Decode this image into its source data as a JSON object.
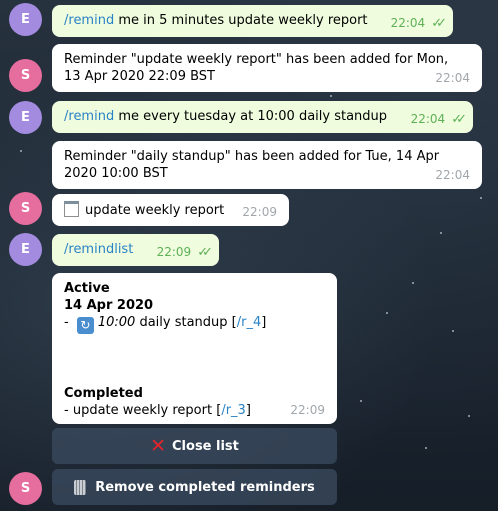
{
  "colors": {
    "outgoing_bubble": "#effdde",
    "incoming_bubble": "#ffffff",
    "link": "#2a83c5",
    "time_outgoing": "#5fb057",
    "avatar_e": "#a38be0",
    "avatar_s": "#e66e9e"
  },
  "avatars": {
    "user": "E",
    "bot": "S"
  },
  "messages": {
    "m1": {
      "command": "/remind",
      "text": "me in 5 minutes update weekly report",
      "time": "22:04"
    },
    "m2": {
      "line1": "Reminder \"update weekly report\" has been added for Mon,",
      "line2": "13 Apr 2020 22:09 BST",
      "time": "22:04"
    },
    "m3": {
      "command": "/remind",
      "text": "me every tuesday at 10:00 daily standup",
      "time": "22:04"
    },
    "m4": {
      "line1": "Reminder \"daily standup\" has been added for Tue, 14 Apr",
      "line2": "2020 10:00 BST",
      "time": "22:04"
    },
    "m5": {
      "icon": "memo-icon",
      "text": "update weekly report",
      "time": "22:09"
    },
    "m6": {
      "command": "/remindlist",
      "time": "22:09"
    },
    "m7": {
      "active_heading": "Active",
      "date": "14 Apr 2020",
      "active_item": {
        "prefix": "-",
        "icon": "repeat-icon",
        "time": "10:00",
        "title": "daily standup",
        "link": "/r_4"
      },
      "completed_heading": "Completed",
      "completed_item": {
        "prefix": "-",
        "title": "update weekly report",
        "link": "/r_3"
      },
      "time": "22:09"
    }
  },
  "buttons": {
    "close": {
      "icon": "cross-mark-icon",
      "label": "Close list"
    },
    "remove": {
      "icon": "wastebasket-icon",
      "label": "Remove completed reminders"
    }
  }
}
